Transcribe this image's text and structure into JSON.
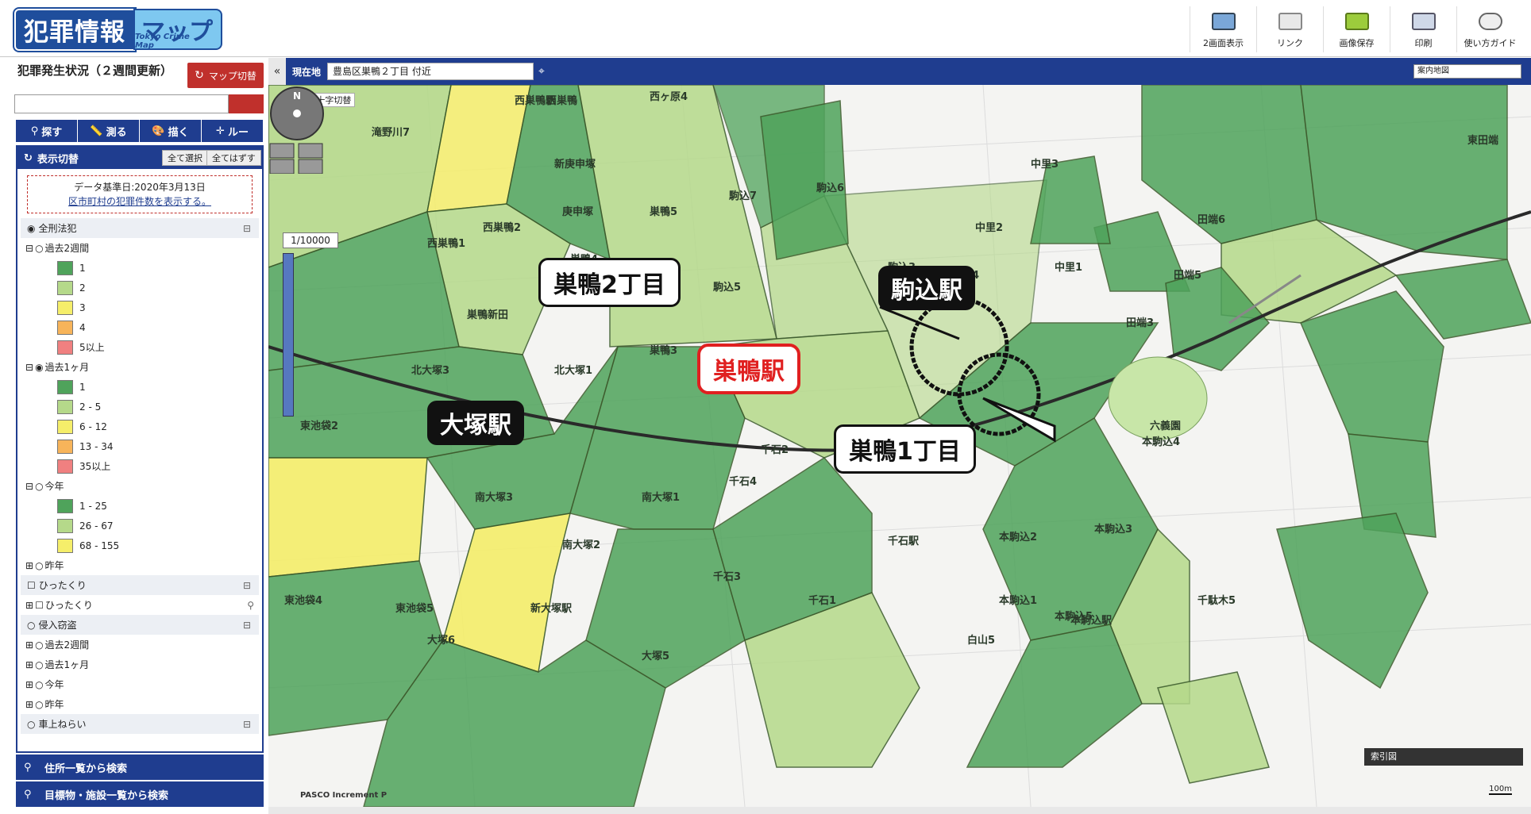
{
  "header": {
    "logo_main": "犯罪情報",
    "logo_sub": "マップ",
    "logo_en": "Tokyo Crime Map",
    "tools": [
      {
        "label": "2画面表示",
        "icon": "dual-screen-icon"
      },
      {
        "label": "リンク",
        "icon": "link-mail-icon"
      },
      {
        "label": "画像保存",
        "icon": "folder-save-icon"
      },
      {
        "label": "印刷",
        "icon": "printer-icon"
      },
      {
        "label": "使い方ガイド",
        "icon": "guide-icon"
      }
    ]
  },
  "sidebar": {
    "situation_title": "犯罪発生状況（２週間更新）",
    "map_switch": "マップ切替",
    "tabs": [
      "探す",
      "測る",
      "描く",
      "ルー"
    ],
    "panel_title": "表示切替",
    "select_all": "全て選択",
    "clear_all": "全てはずす",
    "data_date": "データ基準日:2020年3月13日",
    "data_link": "区市町村の犯罪件数を表示する。",
    "category_all": "全刑法犯",
    "past2w": "過去2週間",
    "past2w_legend": [
      {
        "label": "1",
        "color": "#4fa35b"
      },
      {
        "label": "2",
        "color": "#b5d98a"
      },
      {
        "label": "3",
        "color": "#f5ee6a"
      },
      {
        "label": "4",
        "color": "#f7b45a"
      },
      {
        "label": "5以上",
        "color": "#f08080"
      }
    ],
    "past1m": "過去1ヶ月",
    "past1m_legend": [
      {
        "label": "1",
        "color": "#4fa35b"
      },
      {
        "label": "2 - 5",
        "color": "#b5d98a"
      },
      {
        "label": "6 - 12",
        "color": "#f5ee6a"
      },
      {
        "label": "13 - 34",
        "color": "#f7b45a"
      },
      {
        "label": "35以上",
        "color": "#f08080"
      }
    ],
    "this_year": "今年",
    "this_year_legend": [
      {
        "label": "1 - 25",
        "color": "#4fa35b"
      },
      {
        "label": "26 - 67",
        "color": "#b5d98a"
      },
      {
        "label": "68 - 155",
        "color": "#f5ee6a"
      }
    ],
    "last_year": "昨年",
    "hittakuri_group": "ひったくり",
    "hittakuri_item": "ひったくり",
    "burglary_group": "侵入窃盗",
    "burglary_items": [
      "過去2週間",
      "過去1ヶ月",
      "今年",
      "昨年"
    ],
    "carbreak_group": "車上ねらい",
    "search_address": "住所一覧から検索",
    "search_landmark": "目標物・施設一覧から検索"
  },
  "mapbar": {
    "location_label": "現在地",
    "location_value": "豊島区巣鴨２丁目 付近",
    "guide_map": "案内地図"
  },
  "map": {
    "crosshair": "中心十字切替",
    "compass": "N",
    "scale": "1/10000",
    "index_map": "索引図",
    "credit": "PASCO  Increment P",
    "scale_bar": "100m",
    "callouts": {
      "sugamo_2": "巣鴨2丁目",
      "sugamo_station": "巣鴨駅",
      "sugamo_1": "巣鴨1丁目",
      "komagome_station": "駒込駅",
      "otsuka_station": "大塚駅"
    },
    "area_labels": [
      "滝野川7",
      "西巣鴨",
      "西巣鴨1",
      "西巣鴨2",
      "新庚申塚",
      "庚申塚",
      "巣鴨4",
      "巣鴨5",
      "駒込7",
      "駒込6",
      "駒込5",
      "駒込3",
      "駒込4",
      "巣鴨3",
      "北大塚1",
      "北大塚3",
      "東池袋2",
      "南大塚3",
      "南大塚1",
      "南大塚2",
      "千石4",
      "千石3",
      "千石2",
      "千石1",
      "白山5",
      "本駒込2",
      "本駒込1",
      "本駒込3",
      "本駒込4",
      "本駒込5",
      "田端3",
      "田端5",
      "田端6",
      "中里2",
      "中里3",
      "中里1",
      "千駄木5",
      "東池袋4",
      "東池袋5",
      "大塚6",
      "大塚5",
      "西ヶ原4",
      "巣鴨新田",
      "千石駅",
      "本駒込駅",
      "新大塚駅",
      "西巣鴨駅",
      "六義園",
      "東田端"
    ]
  }
}
